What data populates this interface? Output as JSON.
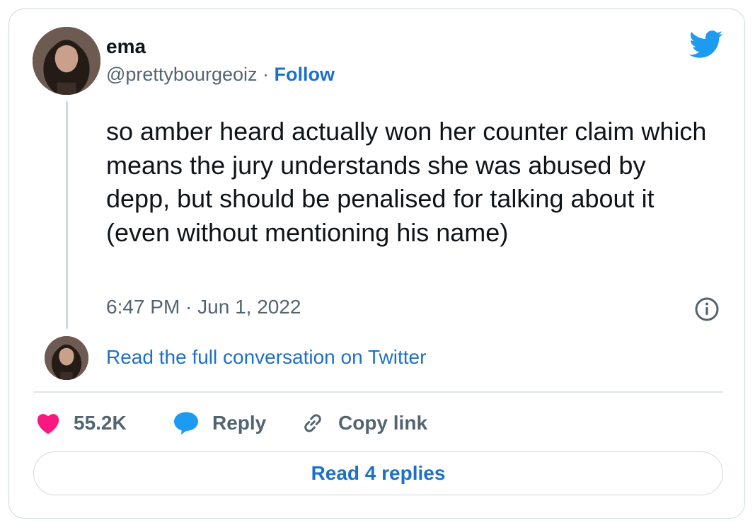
{
  "tweet": {
    "author_name": "ema",
    "handle": "@prettybourgeoiz",
    "separator": " · ",
    "follow_label": "Follow",
    "text": "so amber heard actually won her counter claim which means the jury understands she was abused by depp, but should be penalised for talking about it (even without mentioning his name)",
    "timestamp": "6:47 PM · Jun 1, 2022",
    "read_conversation_label": "Read the full conversation on Twitter"
  },
  "actions": {
    "like_count": "55.2K",
    "reply_label": "Reply",
    "copy_link_label": "Copy link"
  },
  "footer": {
    "read_replies_label": "Read 4 replies"
  },
  "icons": {
    "brand": "twitter-bird-icon",
    "info": "info-icon",
    "like": "heart-icon",
    "reply": "speech-bubble-icon",
    "copy": "link-icon"
  },
  "colors": {
    "link_blue": "#1d70c8",
    "twitter_blue": "#1d9bf0",
    "heart_pink": "#f91880",
    "muted_text": "#536471",
    "border": "#cfd9de"
  }
}
